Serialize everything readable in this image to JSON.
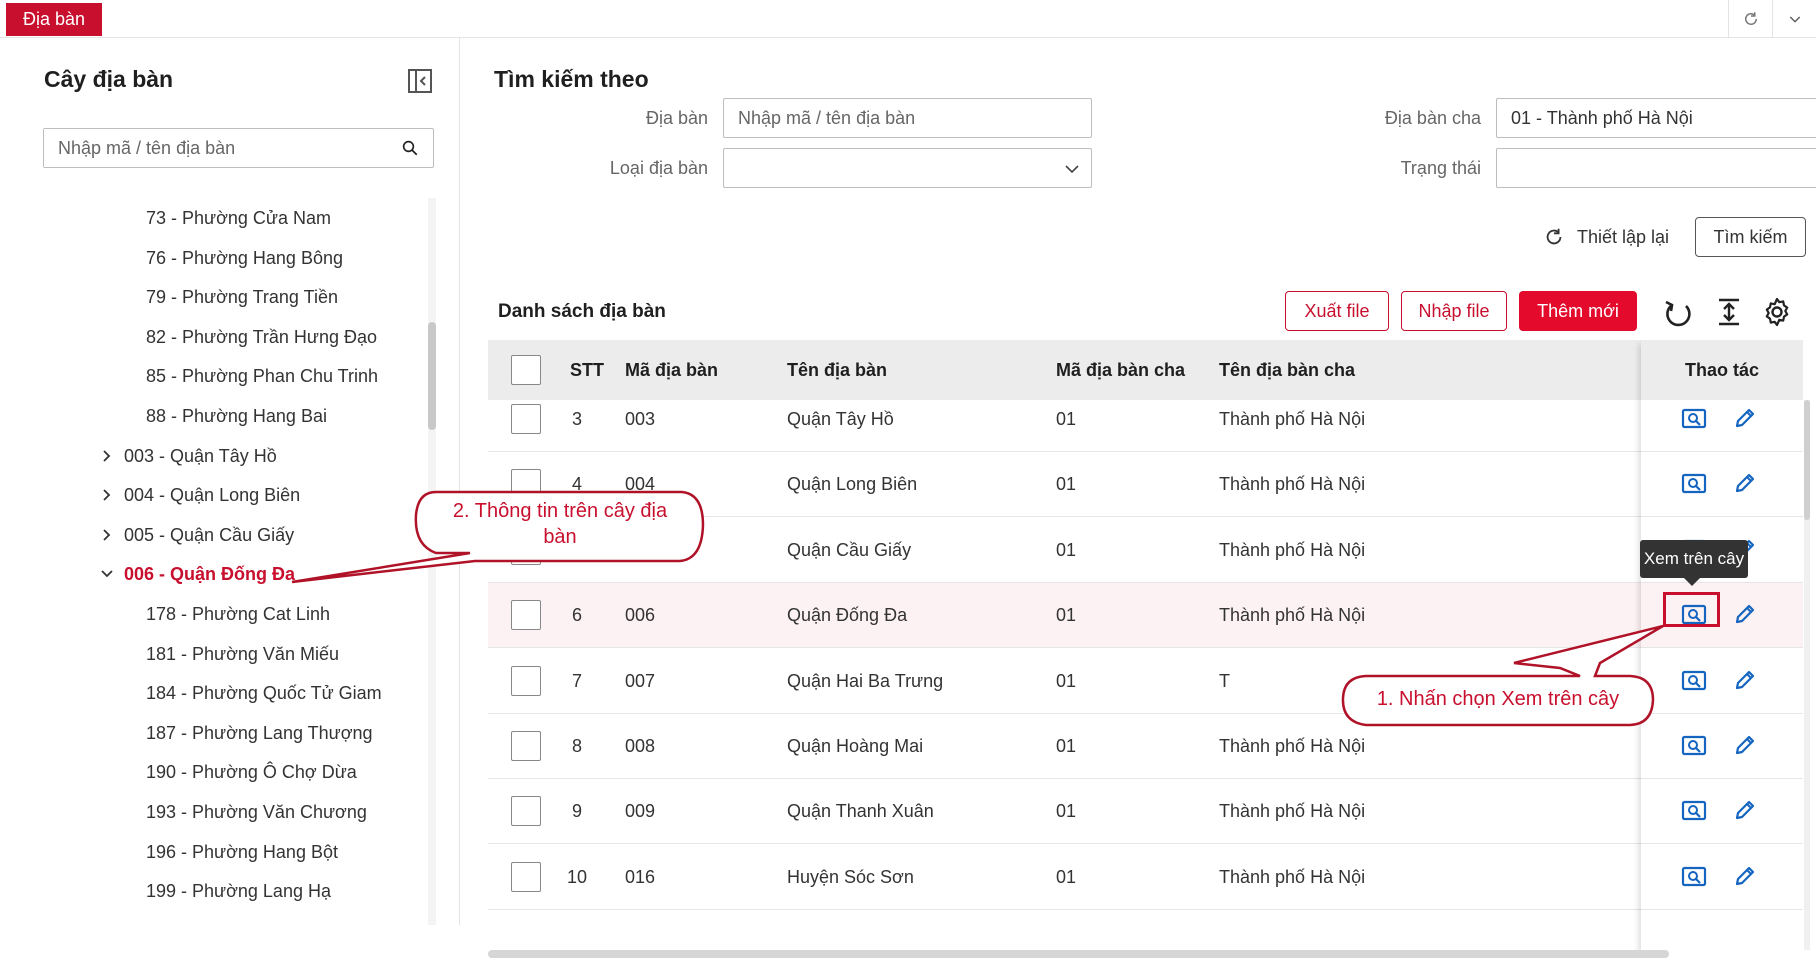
{
  "topbar": {
    "tab_label": "Địa bàn",
    "refresh_icon": "refresh-icon",
    "collapse_icon": "chevron-down-icon"
  },
  "left": {
    "title": "Cây địa bàn",
    "search_placeholder": "Nhập mã / tên địa bàn",
    "tree": [
      {
        "label": "73 - Phường Cửa Nam",
        "level": 2
      },
      {
        "label": "76 - Phường Hang Bông",
        "level": 2
      },
      {
        "label": "79 - Phường Trang Tiền",
        "level": 2
      },
      {
        "label": "82 - Phường Trần Hưng Đạo",
        "level": 2
      },
      {
        "label": "85 - Phường Phan Chu Trinh",
        "level": 2
      },
      {
        "label": "88 - Phường Hang Bai",
        "level": 2
      },
      {
        "label": "003 - Quận Tây Hồ",
        "level": 1,
        "expanded": false
      },
      {
        "label": "004 - Quận Long Biên",
        "level": 1,
        "expanded": false
      },
      {
        "label": "005 - Quận Cầu Giấy",
        "level": 1,
        "expanded": false
      },
      {
        "label": "006 - Quận Đống Đa",
        "level": 1,
        "expanded": true,
        "active": true
      },
      {
        "label": "178 - Phường Cat Linh",
        "level": 2
      },
      {
        "label": "181 - Phường Văn Miếu",
        "level": 2
      },
      {
        "label": "184 - Phường Quốc Tử Giam",
        "level": 2
      },
      {
        "label": "187 - Phường Lang Thượng",
        "level": 2
      },
      {
        "label": "190 - Phường Ô Chợ Dừa",
        "level": 2
      },
      {
        "label": "193 - Phường Văn Chương",
        "level": 2
      },
      {
        "label": "196 - Phường Hang Bột",
        "level": 2
      },
      {
        "label": "199 - Phường Lang Hạ",
        "level": 2
      }
    ]
  },
  "search": {
    "title": "Tìm kiếm theo",
    "dia_ban_label": "Địa bàn",
    "dia_ban_placeholder": "Nhập mã / tên địa bàn",
    "dia_ban_cha_label": "Địa bàn cha",
    "dia_ban_cha_value": "01 - Thành phố Hà Nội",
    "loai_label": "Loại địa bàn",
    "loai_value": "",
    "trang_thai_label": "Trạng thái",
    "trang_thai_value": "",
    "reset_label": "Thiết lập lại",
    "search_label": "Tìm kiếm"
  },
  "list": {
    "title": "Danh sách địa bàn",
    "export_label": "Xuất file",
    "import_label": "Nhập file",
    "add_label": "Thêm mới",
    "columns": {
      "stt": "STT",
      "ma": "Mã địa bàn",
      "ten": "Tên địa bàn",
      "ma_cha": "Mã địa bàn cha",
      "ten_cha": "Tên địa bàn cha",
      "thao_tac": "Thao tác"
    },
    "rows": [
      {
        "stt": "3",
        "ma": "003",
        "ten": "Quận Tây Hồ",
        "ma_cha": "01",
        "ten_cha": "Thành phố Hà Nội"
      },
      {
        "stt": "4",
        "ma": "004",
        "ten": "Quận Long Biên",
        "ma_cha": "01",
        "ten_cha": "Thành phố Hà Nội"
      },
      {
        "stt": "",
        "ma": "",
        "ten": "Quận Cầu Giấy",
        "ma_cha": "01",
        "ten_cha": "Thành phố Hà Nội"
      },
      {
        "stt": "6",
        "ma": "006",
        "ten": "Quận Đống Đa",
        "ma_cha": "01",
        "ten_cha": "Thành phố Hà Nội",
        "highlight": true
      },
      {
        "stt": "7",
        "ma": "007",
        "ten": "Quận Hai Ba Trưng",
        "ma_cha": "01",
        "ten_cha": "T"
      },
      {
        "stt": "8",
        "ma": "008",
        "ten": "Quận Hoàng Mai",
        "ma_cha": "01",
        "ten_cha": "Thành phố Hà Nội"
      },
      {
        "stt": "9",
        "ma": "009",
        "ten": "Quận Thanh Xuân",
        "ma_cha": "01",
        "ten_cha": "Thành phố Hà Nội"
      },
      {
        "stt": "10",
        "ma": "016",
        "ten": "Huyện Sóc Sơn",
        "ma_cha": "01",
        "ten_cha": "Thành phố Hà Nội"
      }
    ]
  },
  "tooltip": "Xem trên cây",
  "callouts": {
    "step1": "1. Nhấn chọn Xem trên cây",
    "step2_line1": "2. Thông tin trên cây địa",
    "step2_line2": "bàn"
  },
  "colors": {
    "brand": "#c8102e",
    "accent_red": "#e30a2c",
    "icon_blue": "#1565c0"
  }
}
